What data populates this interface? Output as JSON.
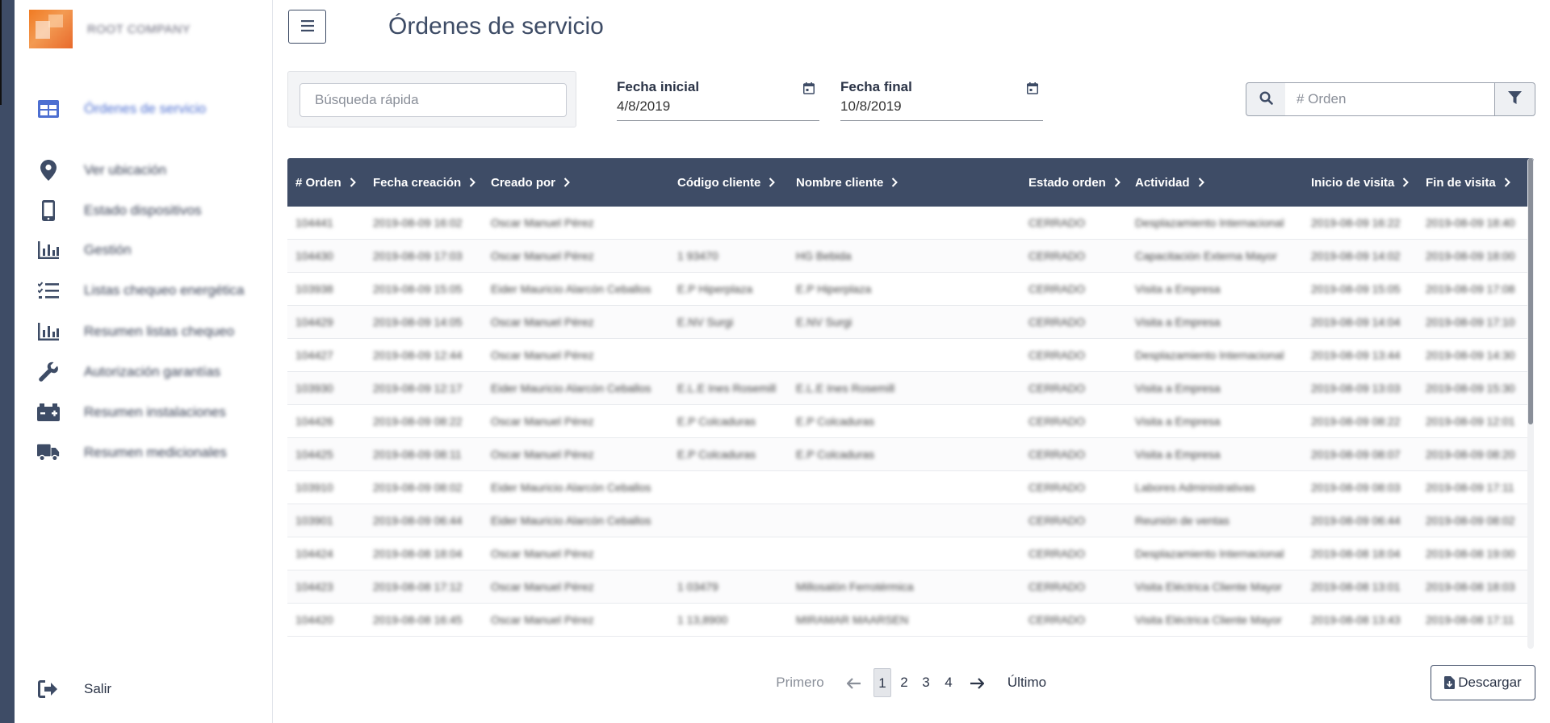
{
  "sidebar": {
    "brand_name": "ROOT COMPANY",
    "items": [
      {
        "label": "Órdenes de servicio",
        "icon": "table-icon",
        "active": true
      },
      {
        "label": "Ver ubicación",
        "icon": "location-pin-icon",
        "active": false
      },
      {
        "label": "Estado dispositivos",
        "icon": "mobile-device-icon",
        "active": false
      },
      {
        "label": "Gestión",
        "icon": "bar-chart-icon",
        "active": false
      },
      {
        "label": "Listas chequeo energética",
        "icon": "checklist-icon",
        "active": false
      },
      {
        "label": "Resumen listas chequeo",
        "icon": "bar-chart-icon",
        "active": false
      },
      {
        "label": "Autorización garantías",
        "icon": "wrench-icon",
        "active": false
      },
      {
        "label": "Resumen instalaciones",
        "icon": "battery-icon",
        "active": false
      },
      {
        "label": "Resumen medicionales",
        "icon": "truck-icon",
        "active": false
      }
    ],
    "logout_label": "Salir"
  },
  "header": {
    "title": "Órdenes de servicio"
  },
  "filters": {
    "quick_search_placeholder": "Búsqueda rápida",
    "start_date_label": "Fecha inicial",
    "start_date_value": "4/8/2019",
    "end_date_label": "Fecha final",
    "end_date_value": "10/8/2019",
    "order_placeholder": "# Orden"
  },
  "table": {
    "columns": [
      "# Orden",
      "Fecha creación",
      "Creado por",
      "Código cliente",
      "Nombre cliente",
      "Estado orden",
      "Actividad",
      "Inicio de visita",
      "Fin de visita"
    ],
    "rows": [
      [
        "104441",
        "2019-08-09 16:02",
        "Oscar Manuel Pérez",
        "",
        "",
        "CERRADO",
        "Desplazamiento Internacional",
        "2019-08-09 16:22",
        "2019-08-09 18:40"
      ],
      [
        "104430",
        "2019-08-09 17:03",
        "Oscar Manuel Pérez",
        "1 93470",
        "HG Bebida",
        "CERRADO",
        "Capacitación Externa Mayor",
        "2019-08-09 14:02",
        "2019-08-09 18:00"
      ],
      [
        "103938",
        "2019-08-09 15:05",
        "Eider Mauricio Alarcón Ceballos",
        "E.P Hiperplaza",
        "E.P Hiperplaza",
        "CERRADO",
        "Visita a Empresa",
        "2019-08-09 15:05",
        "2019-08-09 17:08"
      ],
      [
        "104429",
        "2019-08-09 14:05",
        "Oscar Manuel Pérez",
        "E.NV Surgi",
        "E.NV Surgi",
        "CERRADO",
        "Visita a Empresa",
        "2019-08-09 14:04",
        "2019-08-09 17:10"
      ],
      [
        "104427",
        "2019-08-09 12:44",
        "Oscar Manuel Pérez",
        "",
        "",
        "CERRADO",
        "Desplazamiento Internacional",
        "2019-08-09 13:44",
        "2019-08-09 14:30"
      ],
      [
        "103930",
        "2019-08-09 12:17",
        "Eider Mauricio Alarcón Ceballos",
        "E.L.E Ines Rosemill",
        "E.L.E Ines Rosemill",
        "CERRADO",
        "Visita a Empresa",
        "2019-08-09 13:03",
        "2019-08-09 15:30"
      ],
      [
        "104426",
        "2019-08-09 08:22",
        "Oscar Manuel Pérez",
        "E.P Colcaduras",
        "E.P Colcaduras",
        "CERRADO",
        "Visita a Empresa",
        "2019-08-09 08:22",
        "2019-08-09 12:01"
      ],
      [
        "104425",
        "2019-08-09 08:11",
        "Oscar Manuel Pérez",
        "E.P Colcaduras",
        "E.P Colcaduras",
        "CERRADO",
        "Visita a Empresa",
        "2019-08-09 08:07",
        "2019-08-09 08:20"
      ],
      [
        "103910",
        "2019-08-09 08:02",
        "Eider Mauricio Alarcón Ceballos",
        "",
        "",
        "CERRADO",
        "Labores Administrativas",
        "2019-08-09 08:03",
        "2019-08-09 17:11"
      ],
      [
        "103901",
        "2019-08-09 06:44",
        "Eider Mauricio Alarcón Ceballos",
        "",
        "",
        "CERRADO",
        "Reunión de ventas",
        "2019-08-09 06:44",
        "2019-08-09 08:02"
      ],
      [
        "104424",
        "2019-08-08 18:04",
        "Oscar Manuel Pérez",
        "",
        "",
        "CERRADO",
        "Desplazamiento Internacional",
        "2019-08-08 18:04",
        "2019-08-08 19:00"
      ],
      [
        "104423",
        "2019-08-08 17:12",
        "Oscar Manuel Pérez",
        "1 03479",
        "Millosalón Ferrotérmica",
        "CERRADO",
        "Visita Eléctrica Cliente Mayor",
        "2019-08-08 13:01",
        "2019-08-08 18:03"
      ],
      [
        "104420",
        "2019-08-08 16:45",
        "Oscar Manuel Pérez",
        "1 13,8900",
        "MIRAMAR MAARSEN",
        "CERRADO",
        "Visita Eléctrica Cliente Mayor",
        "2019-08-08 13:43",
        "2019-08-08 17:11"
      ]
    ]
  },
  "pagination": {
    "first_label": "Primero",
    "pages": [
      "1",
      "2",
      "3",
      "4"
    ],
    "current_page": "1",
    "last_label": "Último"
  },
  "download_label": "Descargar",
  "colors": {
    "primary": "#3e4c66",
    "active_nav": "#4d6fd1",
    "brand_orange": "#f07a22"
  }
}
